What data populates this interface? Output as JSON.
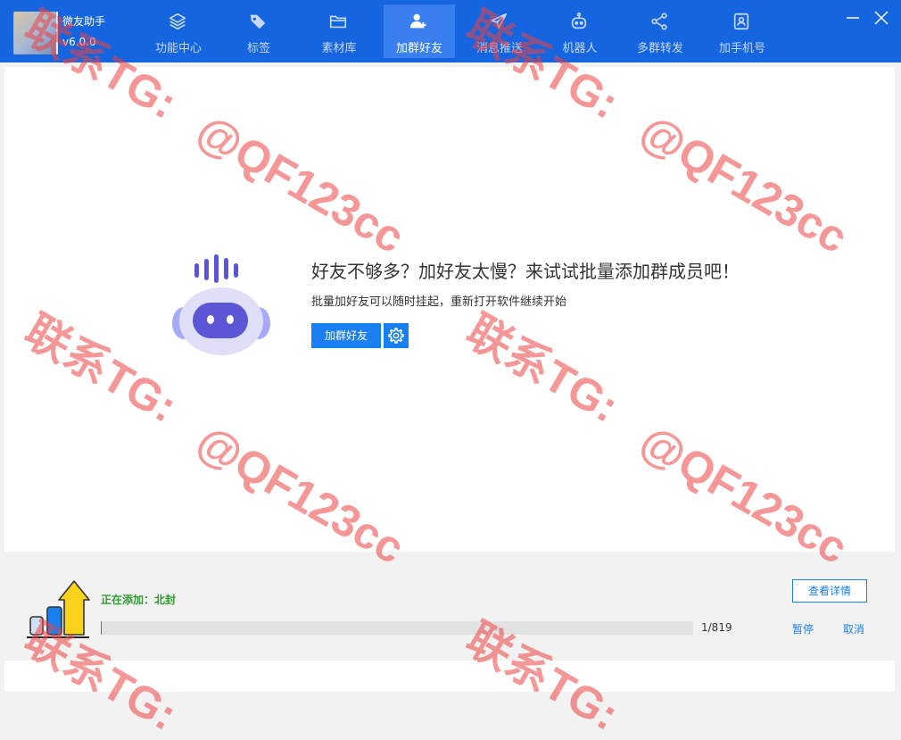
{
  "app": {
    "name": "微友助手",
    "version": "v6.0.0"
  },
  "nav": {
    "tabs": [
      {
        "label": "功能中心",
        "icon": "layers-icon",
        "active": false
      },
      {
        "label": "标签",
        "icon": "tag-icon",
        "active": false
      },
      {
        "label": "素材库",
        "icon": "folder-icon",
        "active": false
      },
      {
        "label": "加群好友",
        "icon": "add-user-icon",
        "active": true
      },
      {
        "label": "消息推送",
        "icon": "paper-plane-icon",
        "active": false
      },
      {
        "label": "机器人",
        "icon": "robot-icon",
        "active": false
      },
      {
        "label": "多群转发",
        "icon": "share-icon",
        "active": false
      },
      {
        "label": "加手机号",
        "icon": "contact-book-icon",
        "active": false
      }
    ]
  },
  "window": {
    "minimize_icon": "minimize-icon",
    "close_icon": "close-icon"
  },
  "promo": {
    "headline": "好友不够多？加好友太慢？来试试批量添加群成员吧！",
    "subline": "批量加好友可以随时挂起，重新打开软件继续开始",
    "primary_button": "加群好友",
    "settings_icon": "gear-icon",
    "illustration_icon": "robot-icon"
  },
  "task": {
    "status": "正在添加：北封",
    "detail_button": "查看详情",
    "current": 1,
    "total": 819,
    "count_text": "1/819",
    "progress_fraction": 0.0012,
    "pause_label": "暂停",
    "cancel_label": "取消"
  },
  "watermark": {
    "line1": "联系TG:",
    "line2": "@QF123cc"
  },
  "colors": {
    "brand": "#1565e0",
    "accent": "#1a7ff0",
    "active_tab": "#3a7ff0",
    "status_green": "#2f9b2f",
    "watermark": "#ec4141"
  }
}
